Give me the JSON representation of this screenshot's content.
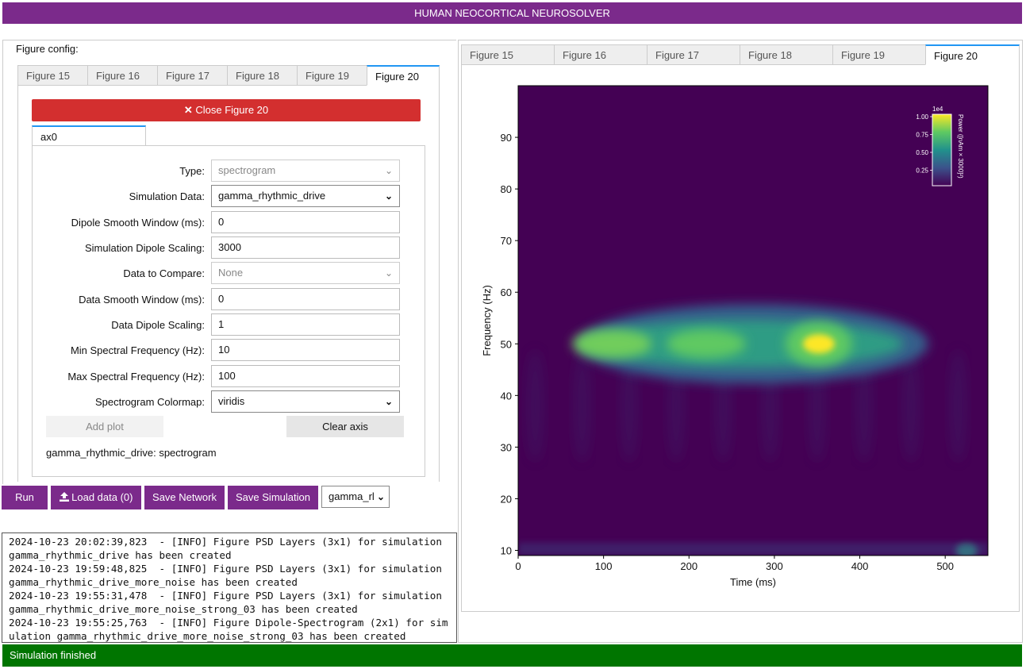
{
  "app_title": "HUMAN NEOCORTICAL NEUROSOLVER",
  "left": {
    "figure_config_label": "Figure config:",
    "tabs": [
      "Figure 15",
      "Figure 16",
      "Figure 17",
      "Figure 18",
      "Figure 19",
      "Figure 20"
    ],
    "active_tab": "Figure 20",
    "close_button": "Close Figure 20",
    "close_icon": "✕",
    "axis_tab": "ax0",
    "fields": {
      "type": {
        "label": "Type:",
        "value": "spectrogram"
      },
      "simulation_data": {
        "label": "Simulation Data:",
        "value": "gamma_rhythmic_drive"
      },
      "dipole_smooth": {
        "label": "Dipole Smooth Window (ms):",
        "value": "0"
      },
      "sim_dipole_scaling": {
        "label": "Simulation Dipole Scaling:",
        "value": "3000"
      },
      "data_to_compare": {
        "label": "Data to Compare:",
        "value": "None"
      },
      "data_smooth": {
        "label": "Data Smooth Window (ms):",
        "value": "0"
      },
      "data_dipole_scaling": {
        "label": "Data Dipole Scaling:",
        "value": "1"
      },
      "min_freq": {
        "label": "Min Spectral Frequency (Hz):",
        "value": "10"
      },
      "max_freq": {
        "label": "Max Spectral Frequency (Hz):",
        "value": "100"
      },
      "colormap": {
        "label": "Spectrogram Colormap:",
        "value": "viridis"
      }
    },
    "add_plot": "Add plot",
    "clear_axis": "Clear axis",
    "plot_summary": "gamma_rhythmic_drive: spectrogram"
  },
  "actions": {
    "run": "Run",
    "load_data": "Load data (0)",
    "upload_icon": "upload-icon",
    "save_network": "Save Network",
    "save_simulation": "Save Simulation",
    "simulation_select": "gamma_rl"
  },
  "log_lines": [
    "2024-10-23 20:02:39,823  - [INFO] Figure PSD Layers (3x1) for simulation gamma_rhythmic_drive has been created",
    "2024-10-23 19:59:48,825  - [INFO] Figure PSD Layers (3x1) for simulation gamma_rhythmic_drive_more_noise has been created",
    "2024-10-23 19:55:31,478  - [INFO] Figure PSD Layers (3x1) for simulation gamma_rhythmic_drive_more_noise_strong_03 has been created",
    "2024-10-23 19:55:25,763  - [INFO] Figure Dipole-Spectrogram (2x1) for simulation gamma_rhythmic_drive_more_noise_strong_03 has been created"
  ],
  "right": {
    "tabs": [
      "Figure 15",
      "Figure 16",
      "Figure 17",
      "Figure 18",
      "Figure 19",
      "Figure 20"
    ],
    "active_tab": "Figure 20"
  },
  "status": "Simulation finished",
  "colors": {
    "brand_purple": "#7b2a8b",
    "close_red": "#d32f2f",
    "status_green": "#007500",
    "tab_accent": "#2196f3"
  },
  "chart_data": {
    "type": "heatmap",
    "colormap": "viridis",
    "xlabel": "Time (ms)",
    "ylabel": "Frequency (Hz)",
    "xlim": [
      0,
      550
    ],
    "ylim": [
      9,
      100
    ],
    "x_ticks": [
      0,
      100,
      200,
      300,
      400,
      500
    ],
    "y_ticks": [
      10,
      20,
      30,
      40,
      50,
      60,
      70,
      80,
      90
    ],
    "colorbar": {
      "label": "Power ([nAm × 3000]²)",
      "exponent_label": "1e4",
      "ticks": [
        "1.00",
        "0.75",
        "0.50",
        "0.25"
      ],
      "range": [
        0,
        1.0
      ]
    },
    "features": [
      {
        "desc": "gamma band",
        "freq_center": 50,
        "time_start": 70,
        "time_end": 480,
        "peak_time": 352,
        "peak_value": 1.0
      },
      {
        "desc": "secondary peaks",
        "freq": 50,
        "times": [
          110,
          220
        ],
        "values": [
          0.78,
          0.75
        ]
      },
      {
        "desc": "low-frequency edge",
        "freq": 10,
        "time": 525,
        "value": 0.55
      }
    ]
  }
}
